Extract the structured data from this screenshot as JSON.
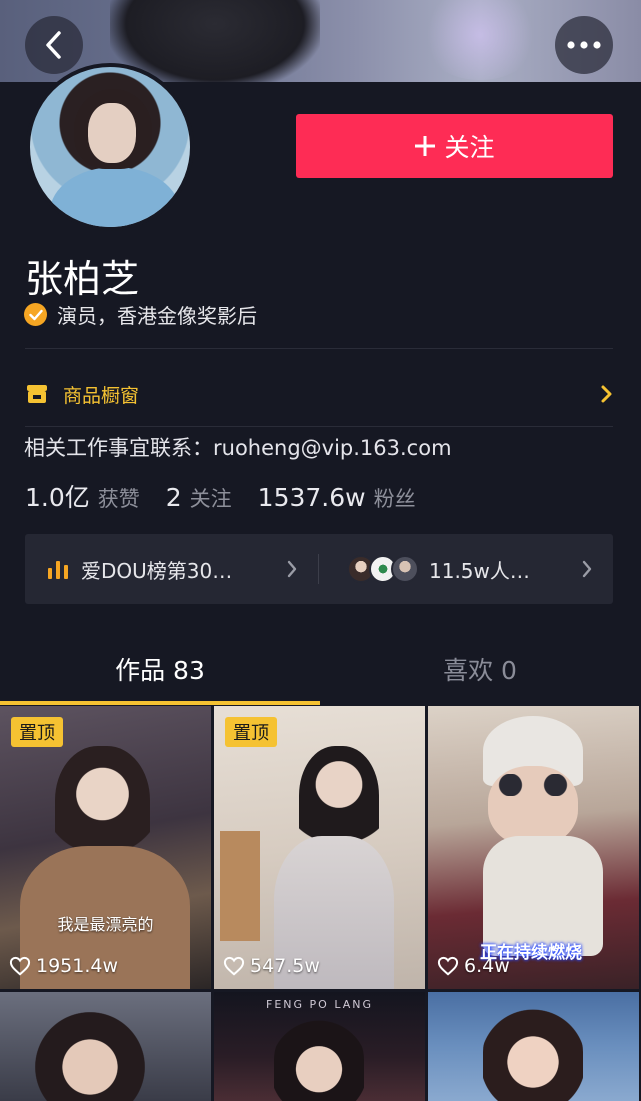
{
  "header": {
    "back_icon": "chevron-left-icon",
    "more_icon": "ellipsis-icon"
  },
  "profile": {
    "name": "张柏芝",
    "verify_text": "演员，香港金像奖影后",
    "follow_label": "关注",
    "contact": "相关工作事宜联系：ruoheng@vip.163.com"
  },
  "shop": {
    "label": "商品橱窗"
  },
  "stats": {
    "likes_value": "1.0亿",
    "likes_label": "获赞",
    "following_value": "2",
    "following_label": "关注",
    "followers_value": "1537.6w",
    "followers_label": "粉丝"
  },
  "rank": {
    "left_text": "爱DOU榜第30…",
    "right_text": "11.5w人…"
  },
  "tabs": [
    {
      "label": "作品 83",
      "active": true
    },
    {
      "label": "喜欢 0",
      "active": false
    }
  ],
  "videos": [
    {
      "pinned": true,
      "pin_label": "置顶",
      "likes": "1951.4w",
      "caption": "我是最漂亮的"
    },
    {
      "pinned": true,
      "pin_label": "置顶",
      "likes": "547.5w"
    },
    {
      "pinned": false,
      "likes": "6.4w",
      "caption": "正在持续燃烧"
    },
    {
      "pinned": false
    },
    {
      "pinned": false,
      "top_text": "FENG PO LANG"
    },
    {
      "pinned": false
    }
  ],
  "colors": {
    "background": "#161823",
    "follow_button": "#fe2c55",
    "accent_yellow": "#f5c232",
    "verify_badge": "#f6a623"
  }
}
